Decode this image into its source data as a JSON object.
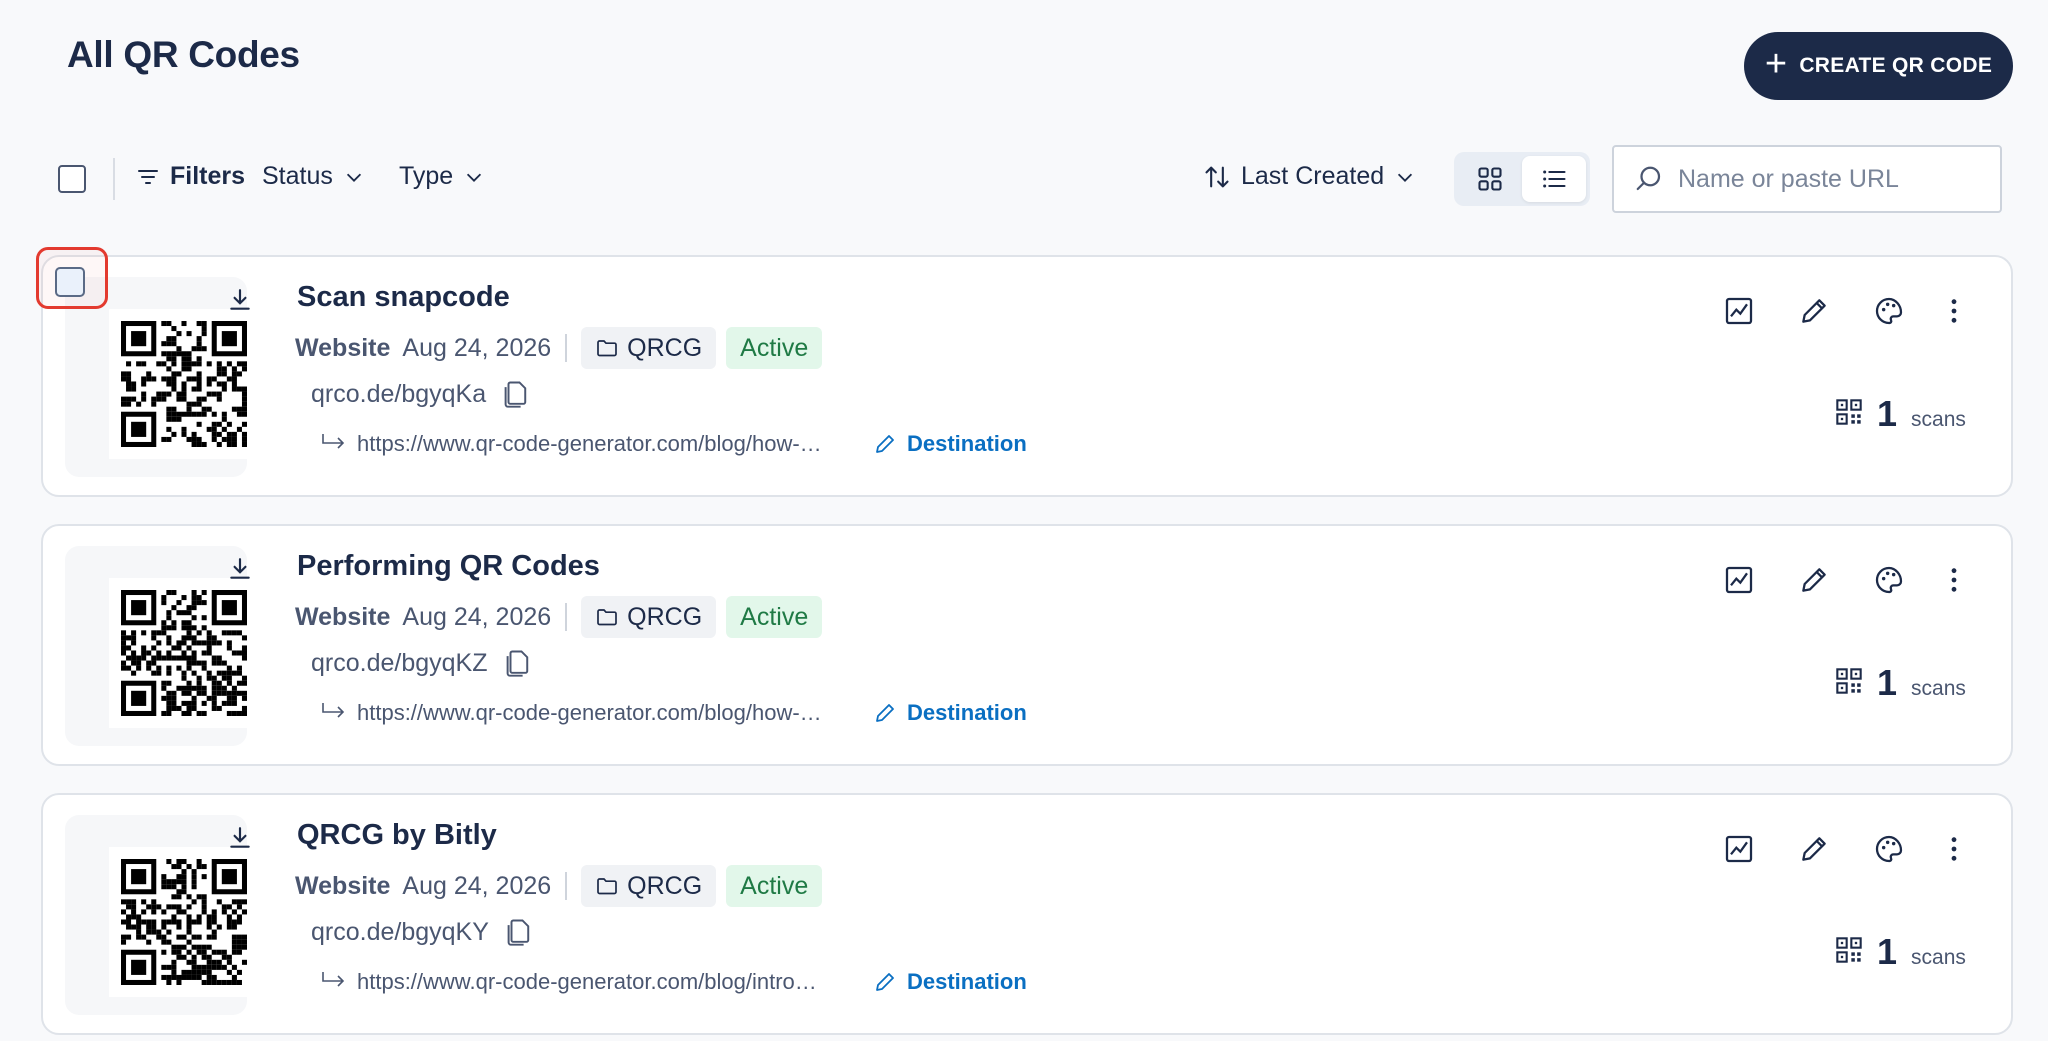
{
  "header": {
    "title": "All QR Codes",
    "create_label": "CREATE QR CODE"
  },
  "toolbar": {
    "filters_label": "Filters",
    "status_label": "Status",
    "type_label": "Type",
    "sort_label": "Last Created",
    "search_placeholder": "Name or paste URL",
    "view_mode": "list"
  },
  "colors": {
    "brand": "#1c2a48",
    "active_bg": "#e2f7ea",
    "active_text": "#1f7a45",
    "link": "#0a6fc2",
    "highlight": "#e33a2f"
  },
  "cards": [
    {
      "title": "Scan snapcode",
      "type": "Website",
      "date": "Aug 24, 2026",
      "folder": "QRCG",
      "status": "Active",
      "short_url": "qrco.de/bgyqKa",
      "destination_url": "https://www.qr-code-generator.com/blog/how-…",
      "destination_label": "Destination",
      "scans": "1",
      "scans_label": "scans"
    },
    {
      "title": "Performing QR Codes",
      "type": "Website",
      "date": "Aug 24, 2026",
      "folder": "QRCG",
      "status": "Active",
      "short_url": "qrco.de/bgyqKZ",
      "destination_url": "https://www.qr-code-generator.com/blog/how-…",
      "destination_label": "Destination",
      "scans": "1",
      "scans_label": "scans"
    },
    {
      "title": "QRCG by Bitly",
      "type": "Website",
      "date": "Aug 24, 2026",
      "folder": "QRCG",
      "status": "Active",
      "short_url": "qrco.de/bgyqKY",
      "destination_url": "https://www.qr-code-generator.com/blog/intro…",
      "destination_label": "Destination",
      "scans": "1",
      "scans_label": "scans"
    }
  ]
}
